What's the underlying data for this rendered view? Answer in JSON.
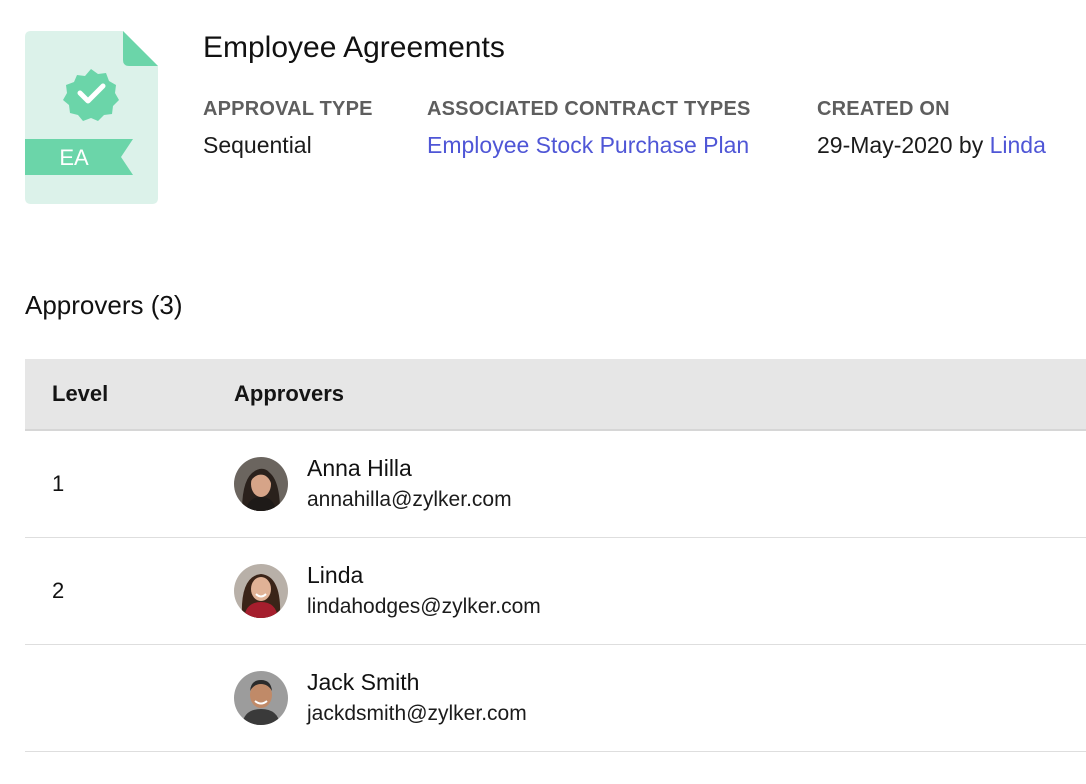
{
  "header": {
    "icon_text": "EA",
    "title": "Employee Agreements",
    "approval_type_label": "APPROVAL TYPE",
    "approval_type_value": "Sequential",
    "contract_types_label": "ASSOCIATED CONTRACT TYPES",
    "contract_types_value": "Employee Stock Purchase Plan",
    "created_on_label": "CREATED ON",
    "created_on_date": "29-May-2020 by",
    "created_by": "Linda"
  },
  "approvers": {
    "section_title": "Approvers (3)",
    "columns": [
      "Level",
      "Approvers"
    ],
    "rows": [
      {
        "level": "1",
        "name": "Anna Hilla",
        "email": "annahilla@zylker.com"
      },
      {
        "level": "2",
        "name": "Linda",
        "email": "lindahodges@zylker.com"
      },
      {
        "level": "",
        "name": "Jack Smith",
        "email": "jackdsmith@zylker.com"
      }
    ]
  },
  "colors": {
    "icon_bg": "#dcf2ea",
    "icon_accent": "#6bd5a9",
    "link": "#4f56d6",
    "header_bg": "#e6e6e6"
  }
}
